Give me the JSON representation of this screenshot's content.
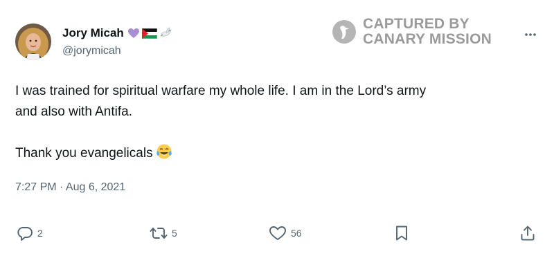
{
  "author": {
    "display_name": "Jory Micah",
    "handle": "@jorymicah",
    "name_emojis": [
      "purple-heart-icon",
      "palestine-flag-icon",
      "dove-icon"
    ]
  },
  "watermark": {
    "line1": "CAPTURED BY",
    "line2": "CANARY MISSION"
  },
  "tweet": {
    "line1": "I was trained for spiritual warfare my whole life. I am in the Lord’s army",
    "line2": "and  also with Antifa.",
    "line3": "Thank you evangelicals",
    "line3_emoji": "face-with-tears-of-joy-icon",
    "timestamp": "7:27 PM · Aug 6, 2021"
  },
  "actions": {
    "replies": "2",
    "retweets": "5",
    "likes": "56"
  },
  "colors": {
    "text": "#0f1419",
    "secondary": "#536471",
    "watermark": "#9a9a9a"
  }
}
